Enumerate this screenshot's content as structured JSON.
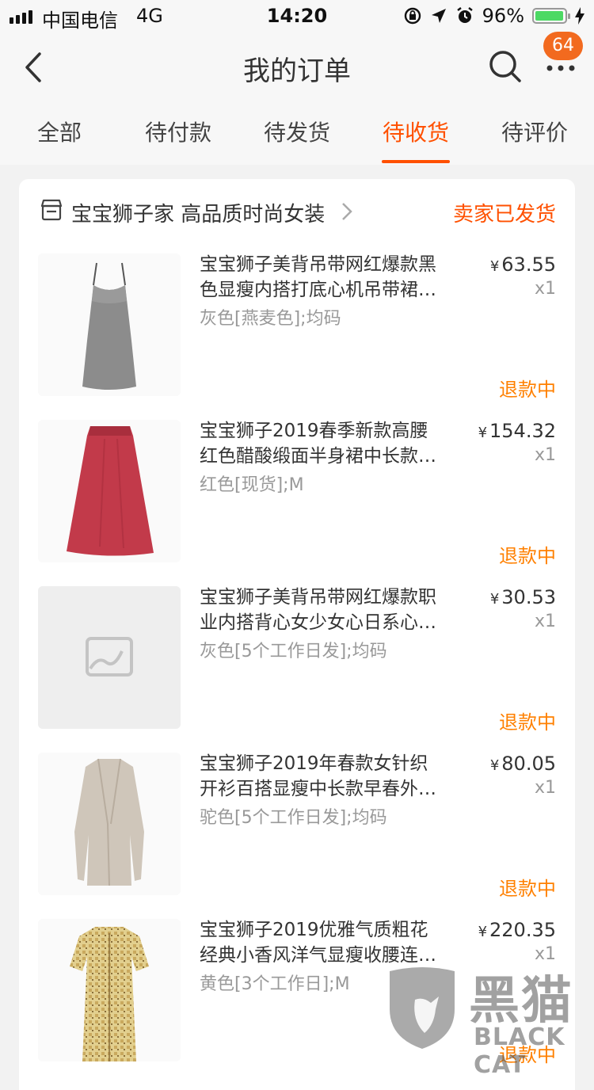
{
  "status_bar": {
    "carrier": "中国电信",
    "network": "4G",
    "time": "14:20",
    "battery": "96%",
    "battery_level": 0.96
  },
  "nav": {
    "title": "我的订单",
    "badge_count": "64"
  },
  "tabs": [
    {
      "label": "全部",
      "active": false
    },
    {
      "label": "待付款",
      "active": false
    },
    {
      "label": "待发货",
      "active": false
    },
    {
      "label": "待收货",
      "active": true
    },
    {
      "label": "待评价",
      "active": false
    }
  ],
  "shop": {
    "name": "宝宝狮子家 高品质时尚女装",
    "status": "卖家已发货"
  },
  "currency_symbol": "¥",
  "items": [
    {
      "title_line1": "宝宝狮子美背吊带网红爆款黑",
      "title_line2": "色显瘦内搭打底心机吊带裙…",
      "sku": "灰色[燕麦色];均码",
      "price": "63.55",
      "qty": "x1",
      "status": "退款中",
      "image": "gray-slip-dress"
    },
    {
      "title_line1": "宝宝狮子2019春季新款高腰",
      "title_line2": "红色醋酸缎面半身裙中长款…",
      "sku": "红色[现货];M",
      "price": "154.32",
      "qty": "x1",
      "status": "退款中",
      "image": "red-satin-skirt"
    },
    {
      "title_line1": "宝宝狮子美背吊带网红爆款职",
      "title_line2": "业内搭背心女少女心日系心…",
      "sku": "灰色[5个工作日发];均码",
      "price": "30.53",
      "qty": "x1",
      "status": "退款中",
      "image": "image-placeholder"
    },
    {
      "title_line1": "宝宝狮子2019年春款女针织",
      "title_line2": "开衫百搭显瘦中长款早春外…",
      "sku": "驼色[5个工作日发];均码",
      "price": "80.05",
      "qty": "x1",
      "status": "退款中",
      "image": "beige-cardigan"
    },
    {
      "title_line1": "宝宝狮子2019优雅气质粗花",
      "title_line2": "经典小香风洋气显瘦收腰连…",
      "sku": "黄色[3个工作日];M",
      "price": "220.35",
      "qty": "x1",
      "status": "退款中",
      "image": "tweed-dress"
    }
  ],
  "watermark": {
    "cn": "黑猫",
    "en": "BLACK CAT"
  },
  "colors": {
    "accent": "#ff5000",
    "refund": "#ff8000",
    "badge": "#f26a1f"
  }
}
